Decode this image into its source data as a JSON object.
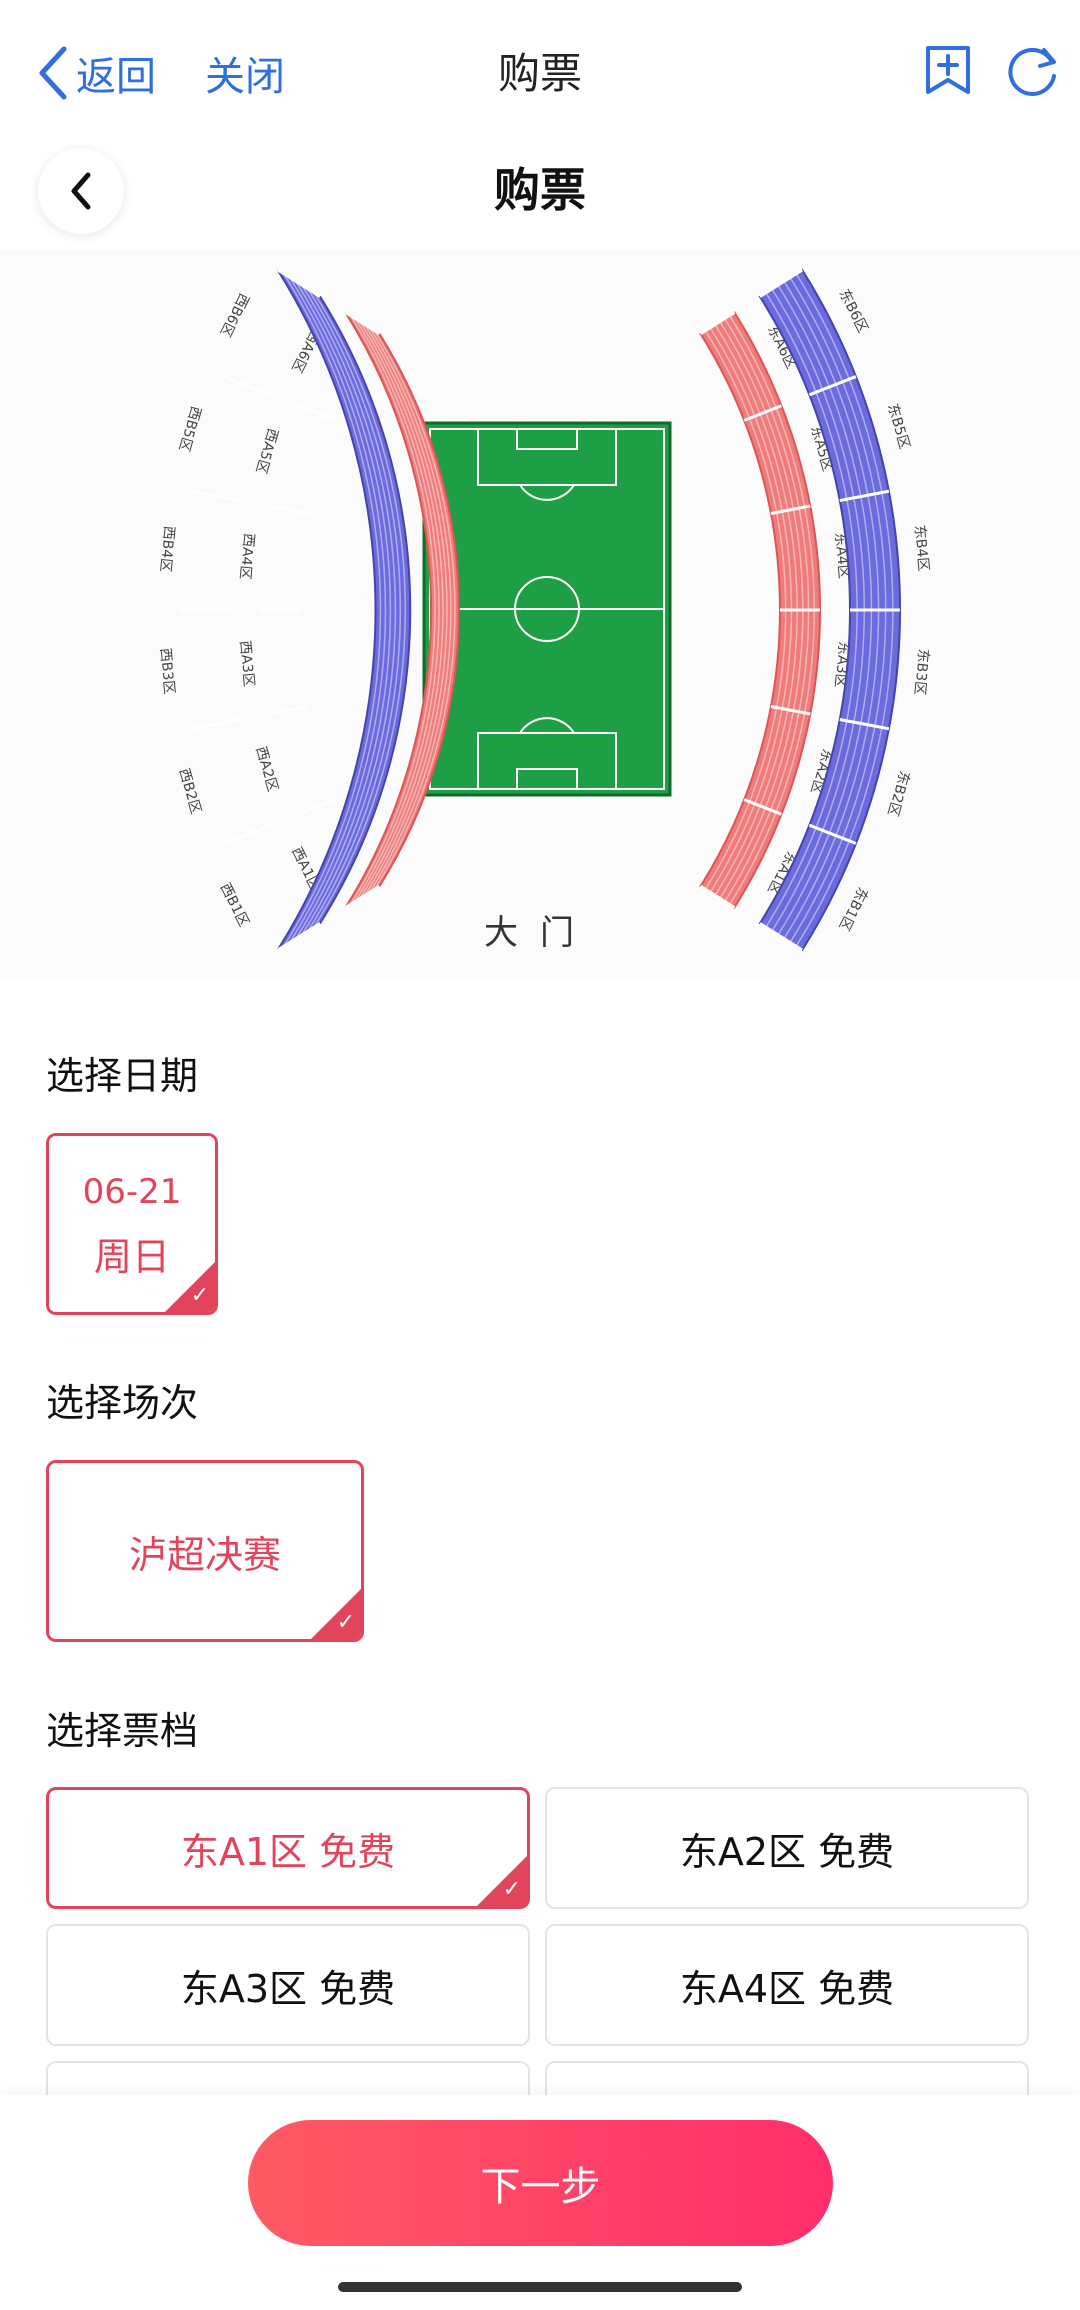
{
  "topbar": {
    "back_label": "返回",
    "close_label": "关闭",
    "title": "购票"
  },
  "subheader": {
    "title": "购票"
  },
  "stadium": {
    "west_outer": [
      "西B6区",
      "西B5区",
      "西B4区",
      "西B3区",
      "西B2区",
      "西B1区"
    ],
    "west_inner": [
      "西A6区",
      "西A5区",
      "西A4区",
      "西A3区",
      "西A2区",
      "西A1区"
    ],
    "east_inner": [
      "东A6区",
      "东A5区",
      "东A4区",
      "东A3区",
      "东A2区",
      "东A1区"
    ],
    "east_outer": [
      "东B6区",
      "东B5区",
      "东B4区",
      "东B3区",
      "东B2区",
      "东B1区"
    ],
    "gate_label": "大门",
    "colors": {
      "outer": "#6b6be0",
      "inner": "#ef7b7b",
      "pitch": "#1e9f45"
    }
  },
  "date_section": {
    "title": "选择日期",
    "date": "06-21",
    "weekday": "周日"
  },
  "session_section": {
    "title": "选择场次",
    "match": "泸超决赛"
  },
  "tier_section": {
    "title": "选择票档",
    "tiers": [
      "东A1区 免费",
      "东A2区 免费",
      "东A3区 免费",
      "东A4区 免费"
    ]
  },
  "next_button": "下一步",
  "accent_color": "#e2445c"
}
